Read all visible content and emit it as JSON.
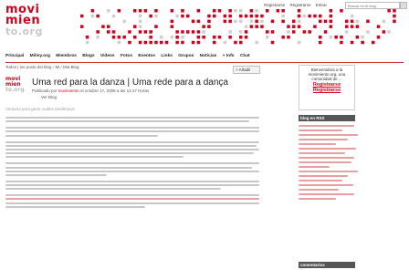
{
  "top": {
    "links": [
      "Registrarse",
      "Registrarse",
      "Entrar"
    ],
    "search_placeholder": "Buscar en el blog"
  },
  "logo": {
    "line1": "movi",
    "line2": "mien",
    "line3": "to.org"
  },
  "nav": [
    "Principal",
    "Mi/my.org",
    "Miembros",
    "Blogs",
    "Videos",
    "Fotos",
    "Eventos",
    "Links",
    "Grupos",
    "Noticias",
    "+ Info",
    "Chat"
  ],
  "crumb": "Todos | los posts del blog  ›  Mi / Mia Blog",
  "add_button": "+ Añadir",
  "post": {
    "title": "Uma red para la danza | Uma rede para a dança",
    "meta_prefix": "Publicado por",
    "author": "movimiento",
    "meta_suffix": " el octubre 17, 2008 a las 14:17 Horas",
    "view_blog": "Ver Blog",
    "tagline": "Ventana para gerar cuáles tendencias"
  },
  "sidebar": {
    "box_text": "Bienvenido/a a la movimiento.org, una comunidad de ...",
    "register": "Registrarse",
    "login": "Registrarse",
    "head1": "blog en RSS",
    "head2": "comentarios"
  },
  "colors": {
    "brand": "#d0021b",
    "nav_line": "#c33"
  }
}
